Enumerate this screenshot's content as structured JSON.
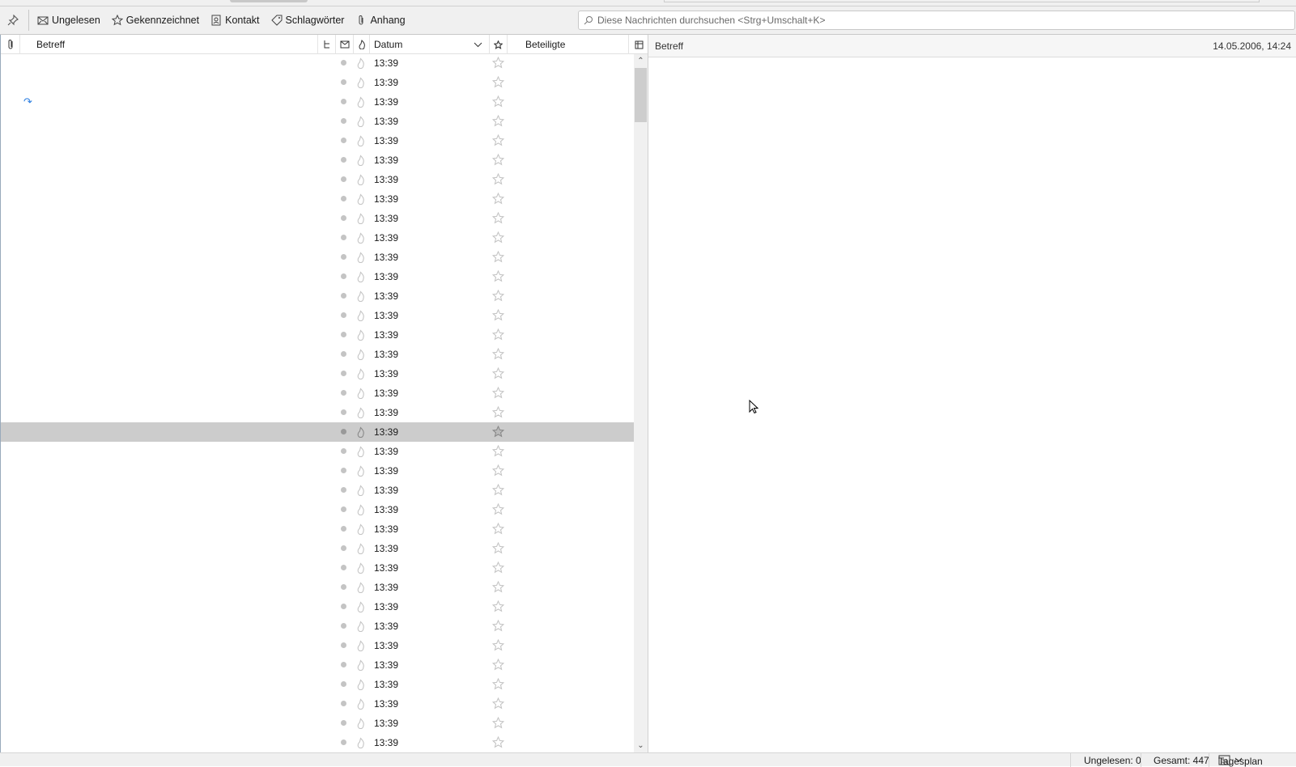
{
  "toolbar": {
    "pin_label": "Pin",
    "filters": [
      {
        "label": "Ungelesen",
        "icon": "envelope-icon"
      },
      {
        "label": "Gekennzeichnet",
        "icon": "star-icon"
      },
      {
        "label": "Kontakt",
        "icon": "contact-icon"
      },
      {
        "label": "Schlagwörter",
        "icon": "tag-icon"
      },
      {
        "label": "Anhang",
        "icon": "paperclip-icon"
      }
    ],
    "search_placeholder": "Diese Nachrichten durchsuchen <Strg+Umschalt+K>"
  },
  "columns": {
    "subject": "Betreff",
    "date": "Datum",
    "participants": "Beteiligte"
  },
  "messages": {
    "time": "13:39",
    "count": 36,
    "selected_index": 19,
    "replied_index": 2
  },
  "reader": {
    "subject_label": "Betreff",
    "date": "14.05.2006, 14:24"
  },
  "status": {
    "unread": "Ungelesen: 0",
    "total": "Gesamt: 447",
    "agenda": "Tagesplan"
  }
}
